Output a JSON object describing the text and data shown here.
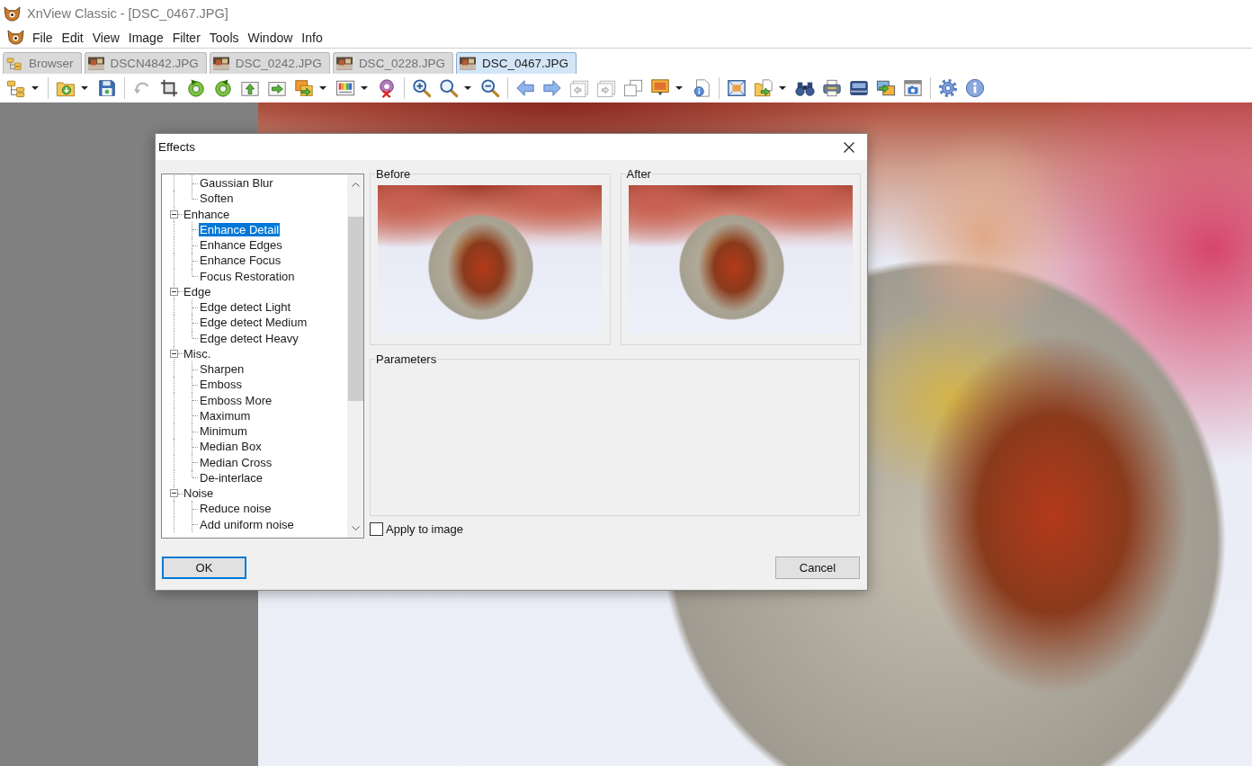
{
  "window": {
    "title": "XnView Classic - [DSC_0467.JPG]"
  },
  "menu": [
    "File",
    "Edit",
    "View",
    "Image",
    "Filter",
    "Tools",
    "Window",
    "Info"
  ],
  "tabs": [
    {
      "label": "Browser",
      "kind": "browser",
      "selected": false
    },
    {
      "label": "DSCN4842.JPG",
      "kind": "image",
      "selected": false
    },
    {
      "label": "DSC_0242.JPG",
      "kind": "image",
      "selected": false
    },
    {
      "label": "DSC_0228.JPG",
      "kind": "image",
      "selected": false
    },
    {
      "label": "DSC_0467.JPG",
      "kind": "image",
      "selected": true
    }
  ],
  "dialog": {
    "title": "Effects",
    "tree": {
      "items": [
        {
          "children": [
            {
              "label": "Gaussian Blur",
              "selected": false
            },
            {
              "label": "Soften",
              "selected": false
            }
          ]
        },
        {
          "label": "Enhance",
          "expanded": true,
          "selected": false,
          "children": [
            {
              "label": "Enhance Detail",
              "selected": true
            },
            {
              "label": "Enhance Edges",
              "selected": false
            },
            {
              "label": "Enhance Focus",
              "selected": false
            },
            {
              "label": "Focus Restoration",
              "selected": false
            }
          ]
        },
        {
          "label": "Edge",
          "expanded": true,
          "selected": false,
          "children": [
            {
              "label": "Edge detect Light",
              "selected": false
            },
            {
              "label": "Edge detect Medium",
              "selected": false
            },
            {
              "label": "Edge detect Heavy",
              "selected": false
            }
          ]
        },
        {
          "label": "Misc.",
          "expanded": true,
          "selected": false,
          "children": [
            {
              "label": "Sharpen",
              "selected": false
            },
            {
              "label": "Emboss",
              "selected": false
            },
            {
              "label": "Emboss More",
              "selected": false
            },
            {
              "label": "Maximum",
              "selected": false
            },
            {
              "label": "Minimum",
              "selected": false
            },
            {
              "label": "Median Box",
              "selected": false
            },
            {
              "label": "Median Cross",
              "selected": false
            },
            {
              "label": "De-interlace",
              "selected": false
            }
          ]
        },
        {
          "label": "Noise",
          "expanded": true,
          "selected": false,
          "children": [
            {
              "label": "Reduce noise",
              "selected": false
            },
            {
              "label": "Add uniform noise",
              "selected": false
            }
          ]
        }
      ]
    },
    "before": {
      "label": "Before"
    },
    "after": {
      "label": "After"
    },
    "parameters": {
      "label": "Parameters"
    },
    "apply_to_image": {
      "label": "Apply to image",
      "checked": false
    },
    "buttons": [
      {
        "label": "OK",
        "default": true
      },
      {
        "label": "Cancel",
        "default": false
      }
    ]
  }
}
